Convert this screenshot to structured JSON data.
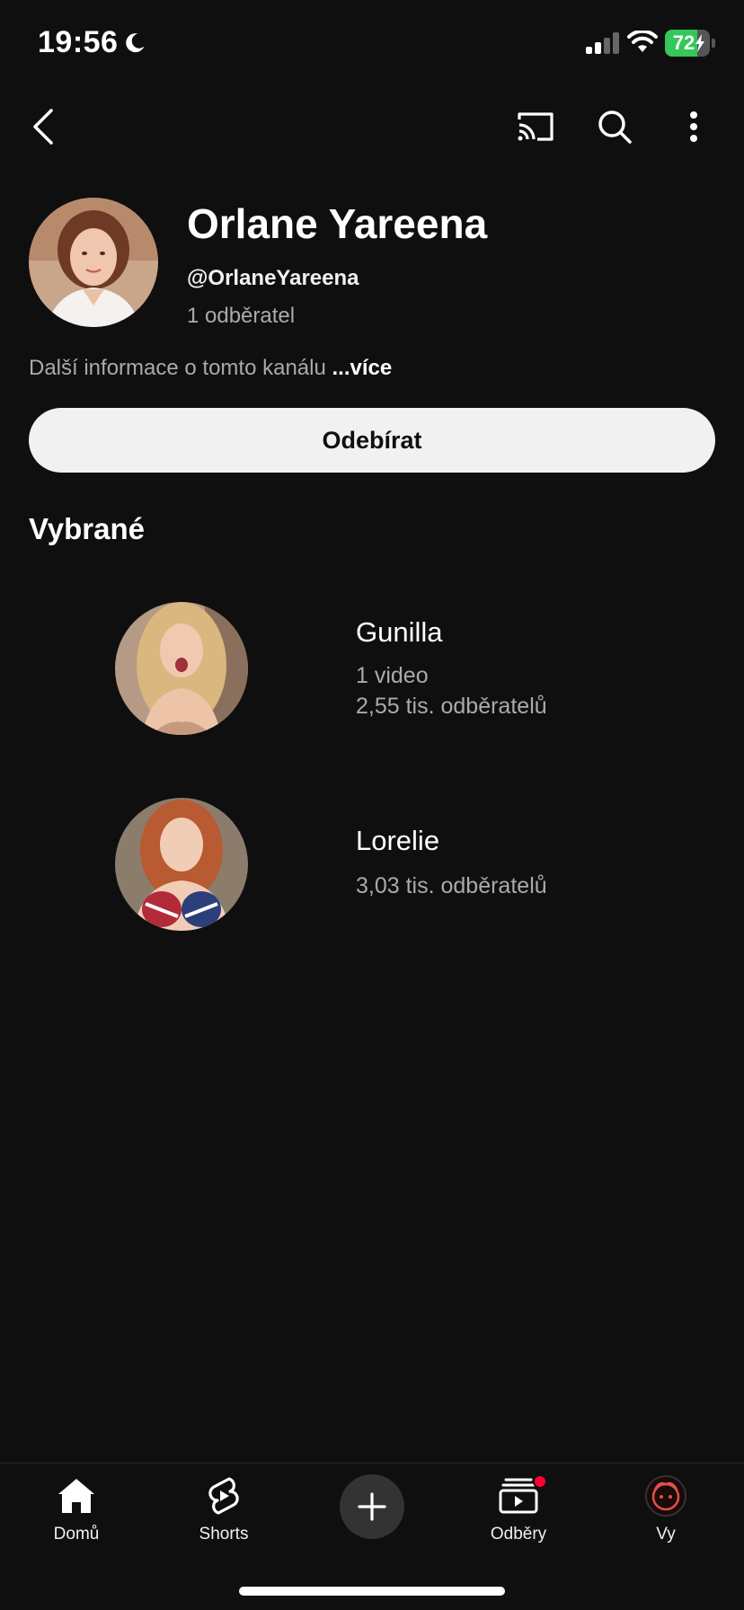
{
  "status_bar": {
    "time": "19:56",
    "battery_percent": "72",
    "battery_level": 0.72,
    "battery_color": "#34c759"
  },
  "app_bar": {
    "icons": [
      "back-icon",
      "cast-icon",
      "search-icon",
      "more-vert-icon"
    ]
  },
  "channel": {
    "name": "Orlane Yareena",
    "handle": "@OrlaneYareena",
    "subscribers": "1 odběratel",
    "about": "Další informace o tomto kanálu",
    "more_label": "...více",
    "subscribe_label": "Odebírat"
  },
  "featured": {
    "title": "Vybrané",
    "items": [
      {
        "name": "Gunilla",
        "videos": "1 video",
        "subscribers": "2,55 tis. odběratelů"
      },
      {
        "name": "Lorelie",
        "subscribers": "3,03 tis. odběratelů"
      }
    ]
  },
  "bottom_nav": {
    "items": [
      {
        "label": "Domů",
        "icon": "home-icon"
      },
      {
        "label": "Shorts",
        "icon": "shorts-icon"
      },
      {
        "label": "",
        "icon": "plus-icon"
      },
      {
        "label": "Odběry",
        "icon": "subscriptions-icon"
      },
      {
        "label": "Vy",
        "icon": "avatar"
      }
    ]
  },
  "colors": {
    "background": "#0f0f0f",
    "text_primary": "#f1f1f1",
    "text_secondary": "#aaaaaa",
    "accent_red": "#ff0033"
  }
}
